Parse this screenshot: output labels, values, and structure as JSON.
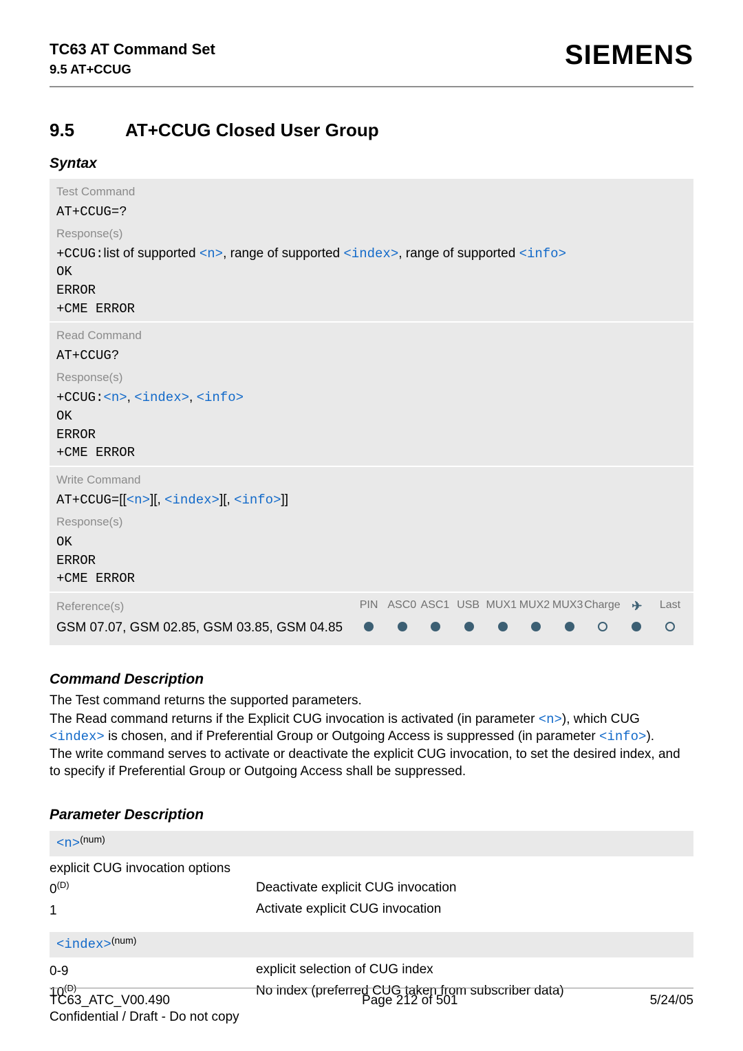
{
  "header": {
    "doc_title": "TC63 AT Command Set",
    "subsection_ref": "9.5 AT+CCUG",
    "brand": "SIEMENS"
  },
  "section": {
    "number": "9.5",
    "title": "AT+CCUG   Closed User Group",
    "syntax_label": "Syntax"
  },
  "test_cmd": {
    "label": "Test Command",
    "cmd": "AT+CCUG=?",
    "response_label": "Response(s)",
    "resp_prefix": "+CCUG:",
    "resp_text_1": "list of supported ",
    "resp_p1": "<n>",
    "resp_text_2": ", range of supported ",
    "resp_p2": "<index>",
    "resp_text_3": ", range of supported ",
    "resp_p3": "<info>",
    "ok": "OK",
    "error": "ERROR",
    "cme": "+CME ERROR"
  },
  "read_cmd": {
    "label": "Read Command",
    "cmd": "AT+CCUG?",
    "response_label": "Response(s)",
    "resp_prefix": "+CCUG:",
    "p1": "<n>",
    "c1": ", ",
    "p2": "<index>",
    "c2": ", ",
    "p3": "<info>",
    "ok": "OK",
    "error": "ERROR",
    "cme": "+CME ERROR"
  },
  "write_cmd": {
    "label": "Write Command",
    "cmd_prefix": "AT+CCUG=",
    "b_open1": "[[",
    "p1": "<n>",
    "b_close1": "][, ",
    "p2": "<index>",
    "b_mid": "][, ",
    "p3": "<info>",
    "b_close2": "]]",
    "response_label": "Response(s)",
    "ok": "OK",
    "error": "ERROR",
    "cme": "+CME ERROR"
  },
  "reference": {
    "label": "Reference(s)",
    "cols": [
      "PIN",
      "ASC0",
      "ASC1",
      "USB",
      "MUX1",
      "MUX2",
      "MUX3",
      "Charge",
      "✈",
      "Last"
    ],
    "specs": "GSM 07.07, GSM 02.85, GSM 03.85, GSM 04.85",
    "dots": [
      "solid",
      "solid",
      "solid",
      "solid",
      "solid",
      "solid",
      "solid",
      "open",
      "solid",
      "open"
    ]
  },
  "cmd_desc": {
    "heading": "Command Description",
    "p1": "The Test command returns the supported parameters.",
    "p2a": "The Read command returns if the Explicit CUG invocation is activated (in parameter ",
    "p2_n": "<n>",
    "p2b": "), which CUG ",
    "p2_index": "<index>",
    "p2c": " is chosen, and if Preferential Group or Outgoing Access is suppressed (in parameter ",
    "p2_info": "<info>",
    "p2d": ").",
    "p3": "The write command serves to activate or deactivate the explicit CUG invocation, to set the desired index, and to specify if Preferential Group or Outgoing Access shall be suppressed."
  },
  "param_desc": {
    "heading": "Parameter Description",
    "n_name": "<n>",
    "n_sup": "(num)",
    "n_caption": "explicit CUG invocation options",
    "n_rows": [
      {
        "k": "0",
        "ksup": "(D)",
        "v": "Deactivate explicit CUG invocation"
      },
      {
        "k": "1",
        "ksup": "",
        "v": "Activate explicit CUG invocation"
      }
    ],
    "index_name": "<index>",
    "index_sup": "(num)",
    "index_rows": [
      {
        "k": "0-9",
        "ksup": "",
        "v": "explicit selection of CUG index"
      },
      {
        "k": "10",
        "ksup": "(D)",
        "v": "No index (preferred CUG taken from subscriber data)"
      }
    ]
  },
  "footer": {
    "left1": "TC63_ATC_V00.490",
    "center": "Page 212 of 501",
    "right": "5/24/05",
    "left2": "Confidential / Draft - Do not copy"
  }
}
